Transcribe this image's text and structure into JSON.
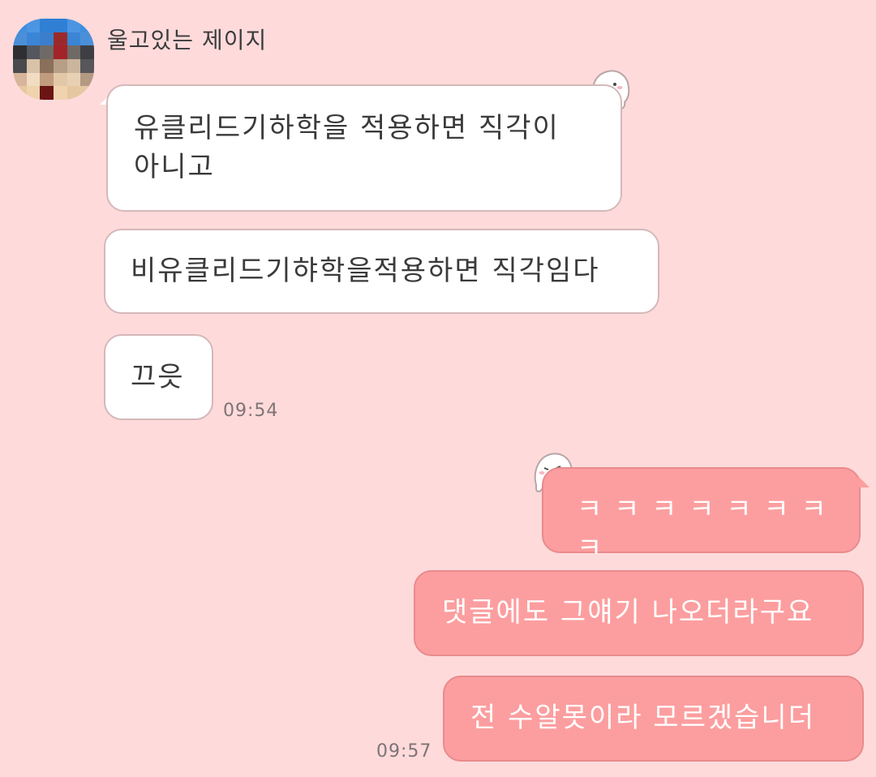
{
  "sender": {
    "name": "울고있는 제이지"
  },
  "messages_in": [
    {
      "text_line1": "유클리드기하학을 적용하면 직각이",
      "text_line2": "아니고"
    },
    {
      "text": "비유클리드기햐학을적용하면 직각임다"
    },
    {
      "text": "끄읏"
    }
  ],
  "time_in": "09:54",
  "messages_out": [
    {
      "text": "ㅋ ㅋ ㅋ ㅋ ㅋ ㅋ ㅋ ㅋ"
    },
    {
      "text": "댓글에도 그얘기 나오더라구요"
    },
    {
      "text": "전 수알못이라 모르겠습니더"
    }
  ],
  "time_out": "09:57",
  "colors": {
    "background": "#fedadb",
    "incoming_bubble": "#ffffff",
    "outgoing_bubble": "#fc9e9f"
  }
}
